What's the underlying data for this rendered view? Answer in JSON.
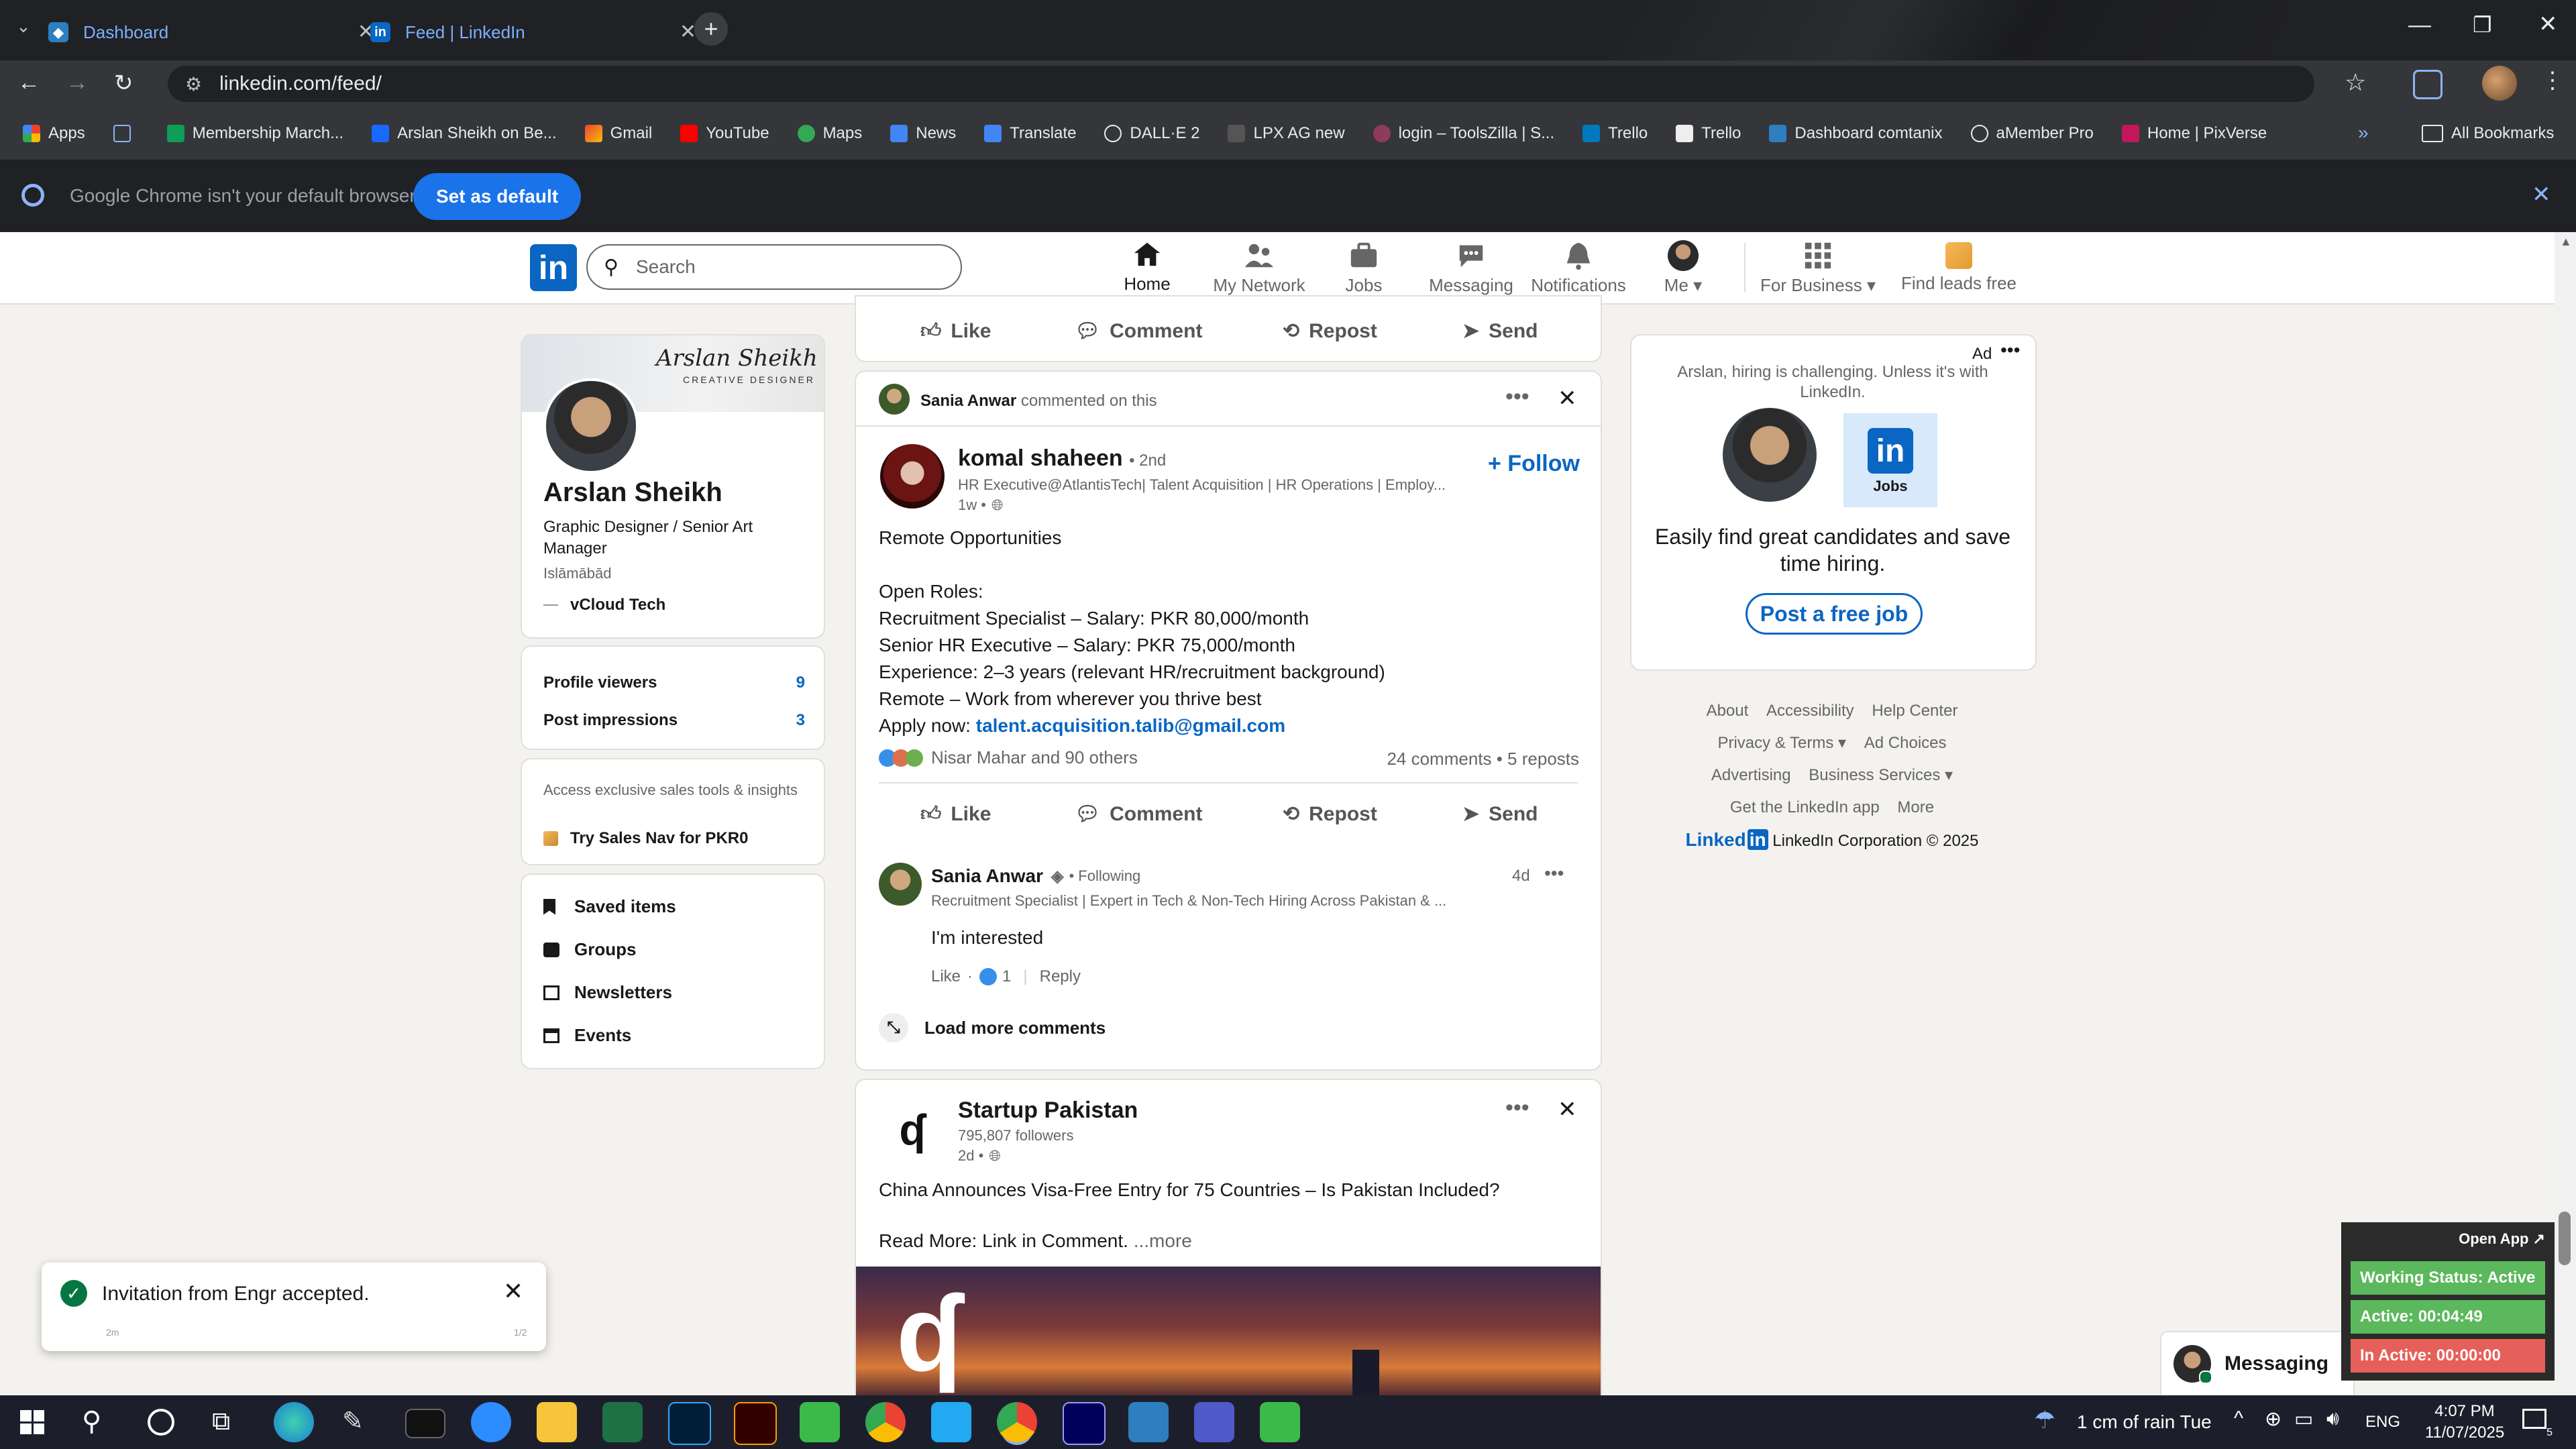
{
  "browser": {
    "tabs": [
      {
        "title": "Dashboard",
        "active": false
      },
      {
        "title": "Feed | LinkedIn",
        "active": true
      }
    ],
    "url": "linkedin.com/feed/",
    "bookmarks": [
      "Apps",
      "Membership March...",
      "Arslan Sheikh on Be...",
      "Gmail",
      "YouTube",
      "Maps",
      "News",
      "Translate",
      "DALL·E 2",
      "LPX AG new",
      "login – ToolsZilla | S...",
      "Trello",
      "Trello",
      "Dashboard comtanix",
      "aMember Pro",
      "Home | PixVerse"
    ],
    "all_bookmarks": "All Bookmarks",
    "infobar_text": "Google Chrome isn't your default browser",
    "set_default": "Set as default"
  },
  "linkedin_nav": {
    "search_placeholder": "Search",
    "items": [
      "Home",
      "My Network",
      "Jobs",
      "Messaging",
      "Notifications",
      "Me",
      "For Business",
      "Find leads free"
    ]
  },
  "profile": {
    "banner_name": "Arslan Sheikh",
    "banner_sub": "CREATIVE DESIGNER",
    "name": "Arslan Sheikh",
    "headline": "Graphic Designer / Senior Art Manager",
    "location": "Islāmābād",
    "company": "vCloud Tech",
    "stats": [
      {
        "label": "Profile viewers",
        "value": "9"
      },
      {
        "label": "Post impressions",
        "value": "3"
      }
    ],
    "premium_text": "Access exclusive sales tools & insights",
    "premium_cta": "Try Sales Nav for PKR0",
    "links": [
      "Saved items",
      "Groups",
      "Newsletters",
      "Events"
    ]
  },
  "feed": {
    "top_actions": [
      "Like",
      "Comment",
      "Repost",
      "Send"
    ],
    "post1": {
      "context_name": "Sania Anwar",
      "context_text": "commented on this",
      "author": "komal shaheen",
      "degree": "• 2nd",
      "headline": "HR Executive@AtlantisTech| Talent Acquisition | HR Operations | Employ...",
      "time": "1w •",
      "follow": "+ Follow",
      "body": [
        "Remote Opportunities",
        "",
        "Open Roles:",
        "Recruitment Specialist – Salary: PKR 80,000/month",
        "Senior HR Executive – Salary: PKR 75,000/month",
        "Experience: 2–3 years (relevant HR/recruitment background)",
        "Remote – Work from wherever you thrive best"
      ],
      "apply_label": "Apply now:",
      "apply_email": "talent.acquisition.talib@gmail.com",
      "reactions": "Nisar Mahar and 90 others",
      "counts": "24 comments • 5 reposts",
      "actions": [
        "Like",
        "Comment",
        "Repost",
        "Send"
      ],
      "comment": {
        "name": "Sania Anwar",
        "following": "• Following",
        "headline": "Recruitment Specialist | Expert in Tech & Non-Tech Hiring Across Pakistan & ...",
        "time": "4d",
        "text": "I'm interested",
        "like": "Like",
        "like_count": "1",
        "reply": "Reply"
      },
      "load_more": "Load more comments"
    },
    "post2": {
      "author": "Startup Pakistan",
      "followers": "795,807 followers",
      "time": "2d •",
      "body": "China Announces Visa-Free Entry for 75 Countries – Is Pakistan Included?",
      "read_more": "Read More: Link in Comment.",
      "more": "...more"
    }
  },
  "ad": {
    "label": "Ad",
    "text": "Arslan, hiring is challenging. Unless it's with LinkedIn.",
    "jobs_label": "Jobs",
    "headline": "Easily find great candidates and save time hiring.",
    "cta": "Post a free job"
  },
  "footer": {
    "links": [
      "About",
      "Accessibility",
      "Help Center",
      "Privacy & Terms",
      "Ad Choices",
      "Advertising",
      "Business Services",
      "Get the LinkedIn app",
      "More"
    ],
    "brand": "Linked",
    "copyright": "LinkedIn Corporation © 2025"
  },
  "toast": {
    "text": "Invitation from Engr accepted.",
    "left": "2m",
    "right": "1/2"
  },
  "messaging": "Messaging",
  "tracker": {
    "open_app": "Open App ↗",
    "status": "Working Status: Active",
    "active": "Active: 00:04:49",
    "inactive": "In Active: 00:00:00"
  },
  "taskbar": {
    "weather": "1 cm of rain Tue",
    "lang": "ENG",
    "time": "4:07 PM",
    "date": "11/07/2025"
  },
  "colors": {
    "linkedin_blue": "#0a66c2",
    "chrome_dark": "#202124",
    "green": "#5cb85c",
    "red": "#e5605a"
  }
}
